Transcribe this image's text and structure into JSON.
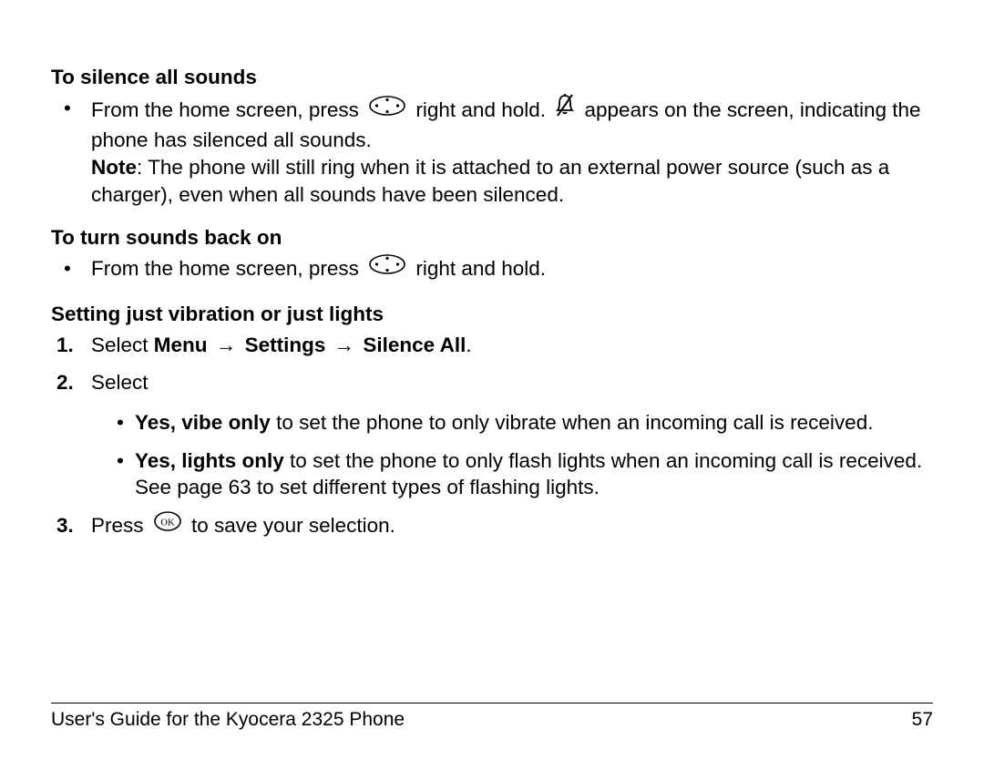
{
  "sections": {
    "silence": {
      "heading": "To silence all sounds",
      "bullet1_a": "From the home screen, press ",
      "bullet1_b": " right and hold. ",
      "bullet1_c": " appears on the screen, indicating the phone has silenced all sounds.",
      "note_label": "Note",
      "note_text": ": The phone will still ring when it is attached to an external power source (such as a charger), even when all sounds have been silenced."
    },
    "sounds_on": {
      "heading": "To turn sounds back on",
      "bullet1_a": "From the home screen, press ",
      "bullet1_b": " right and hold."
    },
    "vibration": {
      "heading": "Setting just vibration or just lights",
      "step1_a": "Select ",
      "step1_menu": "Menu",
      "step1_settings": "Settings",
      "step1_silence": "Silence All",
      "step1_end": ".",
      "step2": "Select",
      "vibe_label": "Yes, vibe only",
      "vibe_text": " to set the phone to only vibrate when an incoming call is received.",
      "lights_label": "Yes, lights only",
      "lights_text": " to set the phone to only flash lights when an incoming call is received. See page 63 to set different types of flashing lights.",
      "step3_a": "Press ",
      "step3_b": " to save your selection."
    }
  },
  "arrow_glyph": "→",
  "footer": {
    "title": "User's Guide for the Kyocera 2325 Phone",
    "page": "57"
  }
}
